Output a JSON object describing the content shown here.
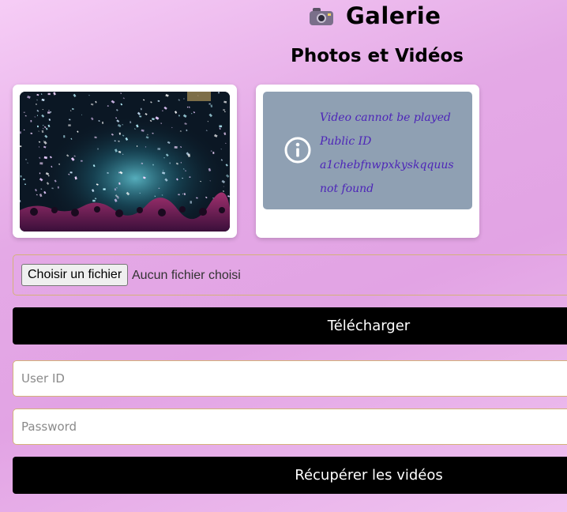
{
  "header": {
    "title": "Galerie",
    "icon": "camera-icon"
  },
  "gallery": {
    "section_title": "Photos et Vidéos",
    "photo": {
      "alt": "Concert crowd with confetti"
    },
    "video": {
      "error_lines": [
        "Video cannot be played",
        "Public ID",
        "a1chebfnwpxkyskqquus",
        "not found"
      ],
      "error_icon": "info-icon"
    }
  },
  "upload": {
    "choose_label": "Choisir un fichier",
    "no_file_label": "Aucun fichier choisi",
    "submit_label": "Télécharger"
  },
  "retrieve": {
    "user_id_placeholder": "User ID",
    "user_id_value": "",
    "password_placeholder": "Password",
    "password_value": "",
    "submit_label": "Récupérer les vidéos"
  },
  "colors": {
    "background": "#e4a9e6",
    "button": "#000000",
    "field_border": "#d4b27a",
    "error_panel": "#8fa0b3",
    "error_text": "#4d25b8"
  }
}
